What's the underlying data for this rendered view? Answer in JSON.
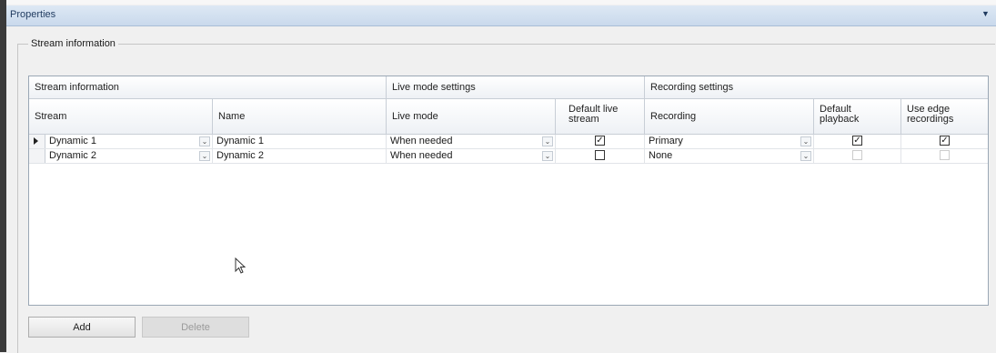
{
  "panel": {
    "title": "Properties",
    "collapse_icon": "chevron-down-icon"
  },
  "group": {
    "legend": "Stream information"
  },
  "grid": {
    "group_headers": [
      "Stream information",
      "Live mode settings",
      "Recording settings"
    ],
    "columns": [
      "Stream",
      "Name",
      "Live mode",
      "Default live\nstream",
      "Recording",
      "Default\nplayback",
      "Use edge\nrecordings"
    ],
    "rows": [
      {
        "current": true,
        "stream": "Dynamic 1",
        "name": "Dynamic 1",
        "live_mode": "When needed",
        "default_live": true,
        "recording": "Primary",
        "default_playback": true,
        "default_playback_enabled": true,
        "use_edge": true,
        "use_edge_enabled": true
      },
      {
        "current": false,
        "stream": "Dynamic 2",
        "name": "Dynamic 2",
        "live_mode": "When needed",
        "default_live": false,
        "recording": "None",
        "default_playback": false,
        "default_playback_enabled": false,
        "use_edge": false,
        "use_edge_enabled": false
      }
    ]
  },
  "buttons": {
    "add": "Add",
    "delete": "Delete"
  },
  "icons": {
    "check": "✓",
    "dropdown": "⌄"
  }
}
